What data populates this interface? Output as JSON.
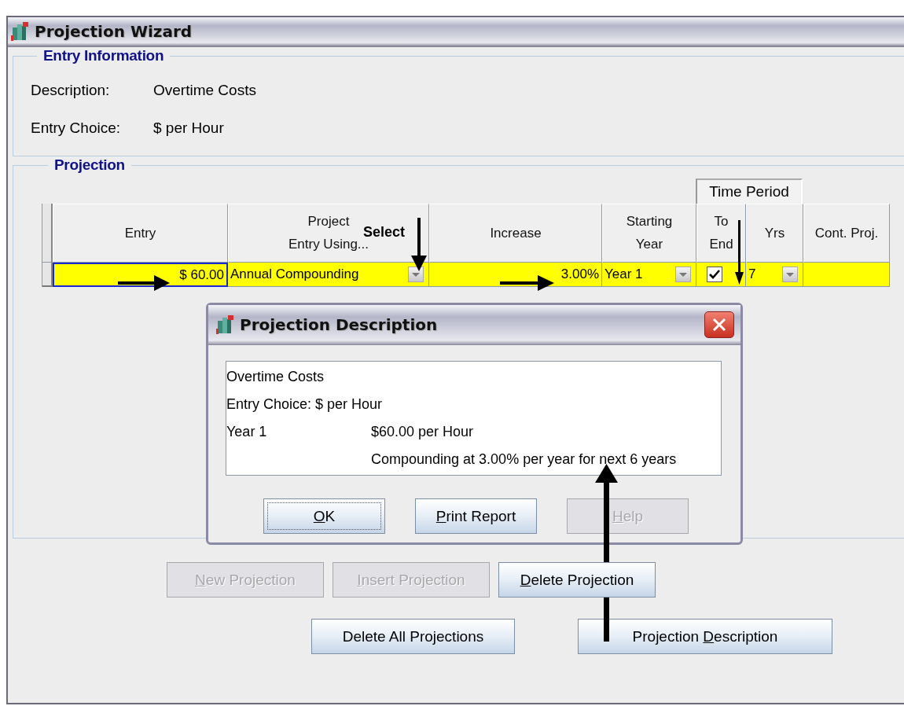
{
  "window": {
    "title": "Projection Wizard"
  },
  "entry_information": {
    "title": "Entry Information",
    "fields": [
      {
        "label": "Description:",
        "value": "Overtime Costs"
      },
      {
        "label": "Entry Choice:",
        "value": "$  per Hour"
      }
    ]
  },
  "projection": {
    "title": "Projection",
    "group_header": "Time Period",
    "columns": [
      {
        "lines": [
          "Entry"
        ]
      },
      {
        "lines": [
          "Project",
          "Entry Using..."
        ]
      },
      {
        "lines": [
          "Increase"
        ]
      },
      {
        "lines": [
          "Starting",
          "Year"
        ]
      },
      {
        "lines": [
          "To",
          "End"
        ]
      },
      {
        "lines": [
          "Yrs"
        ]
      },
      {
        "lines": [
          "Cont. Proj."
        ]
      }
    ],
    "rows": [
      {
        "selected": true,
        "entry": "$ 60.00",
        "entry_focused": true,
        "method": "Annual Compounding",
        "increase": "3.00%",
        "starting_year": "Year 1",
        "to_end": true,
        "yrs": "7"
      }
    ]
  },
  "annotation": {
    "label": "Select"
  },
  "dialog": {
    "title": "Projection Description",
    "lines": [
      {
        "col1": "Overtime Costs"
      },
      {
        "col1": "Entry Choice: $ per Hour"
      },
      {
        "col1": "Year 1",
        "col2": "$60.00 per Hour"
      },
      {
        "col2": "Compounding at 3.00% per year for next 6 years"
      }
    ],
    "buttons": [
      {
        "key": "O",
        "after": "K",
        "disabled": false,
        "focused": true
      },
      {
        "key": "P",
        "after": "rint Report",
        "disabled": false,
        "focused": false
      },
      {
        "key": "H",
        "after": "elp",
        "disabled": true,
        "focused": false
      }
    ]
  },
  "button_rows": [
    [
      {
        "key": "N",
        "after": "ew Projection",
        "disabled": true
      },
      {
        "key": "I",
        "after": "nsert Projection",
        "disabled": true
      },
      {
        "key": "D",
        "after": "elete Projection",
        "disabled": false
      }
    ],
    [
      {
        "before": "Delete All Projections",
        "disabled": false
      },
      {
        "before": "Projection ",
        "key": "D",
        "after": "escription",
        "disabled": false
      }
    ]
  ]
}
